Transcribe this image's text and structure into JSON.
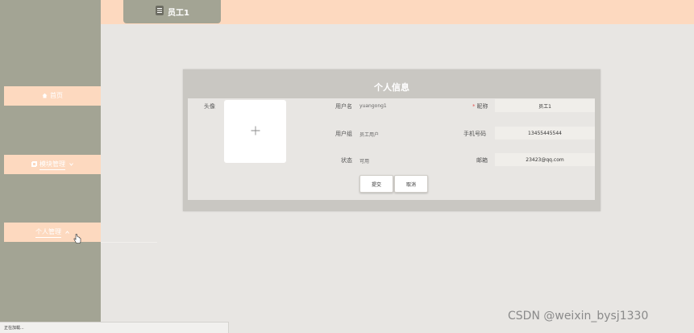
{
  "header": {
    "user_tab_label": "员工1"
  },
  "sidebar": {
    "items": [
      {
        "label": "首页"
      },
      {
        "label": "模块管理"
      },
      {
        "label": "个人管理"
      }
    ]
  },
  "card": {
    "title": "个人信息",
    "fields": {
      "avatar_label": "头像",
      "avatar_upload_symbol": "+",
      "username_label": "用户名",
      "username_value": "yuangong1",
      "usergroup_label": "用户组",
      "usergroup_value": "员工用户",
      "status_label": "状态",
      "status_value": "可用",
      "nickname_label": "昵称",
      "nickname_value": "员工1",
      "phone_label": "手机号码",
      "phone_value": "13455445544",
      "email_label": "邮箱",
      "email_value": "23423@qq.com"
    },
    "submit_label": "提交",
    "cancel_label": "取消"
  },
  "status_bar": {
    "text": "正在加载..."
  },
  "watermark": {
    "text": "CSDN @weixin_bysj1330"
  },
  "colors": {
    "sidebar": "#a3a494",
    "accent": "#fdd9bf",
    "background": "#e8e6e3",
    "card": "#c9c7c2",
    "required": "#e45a5a"
  },
  "icons": [
    "document-icon",
    "home-icon",
    "module-icon",
    "chevron-down-icon",
    "plus-icon",
    "hand-cursor-icon"
  ]
}
